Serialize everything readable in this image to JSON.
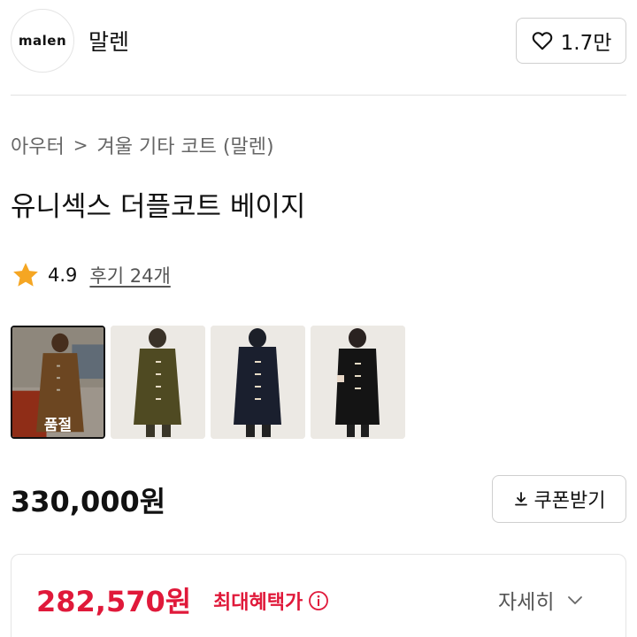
{
  "brand": {
    "logo_text": "malen",
    "name": "말렌",
    "likes": "1.7만"
  },
  "breadcrumb": {
    "items": [
      "아우터",
      "겨울 기타 코트 (말렌)"
    ],
    "separator": ">"
  },
  "product": {
    "title": "유니섹스 더플코트 베이지",
    "rating": "4.9",
    "reviews": "후기 24개",
    "thumbnails": [
      {
        "color": "#7a4a24",
        "label": "품절",
        "selected": true
      },
      {
        "color": "#4a4a22",
        "label": "",
        "selected": false
      },
      {
        "color": "#1a1f2e",
        "label": "",
        "selected": false
      },
      {
        "color": "#141414",
        "label": "",
        "selected": false
      }
    ],
    "price": "330,000원",
    "coupon_button": "쿠폰받기"
  },
  "benefit": {
    "price": "282,570원",
    "label": "최대혜택가",
    "detail": "자세히"
  },
  "colors": {
    "accent_red": "#e0193a",
    "star": "#f5a623"
  }
}
